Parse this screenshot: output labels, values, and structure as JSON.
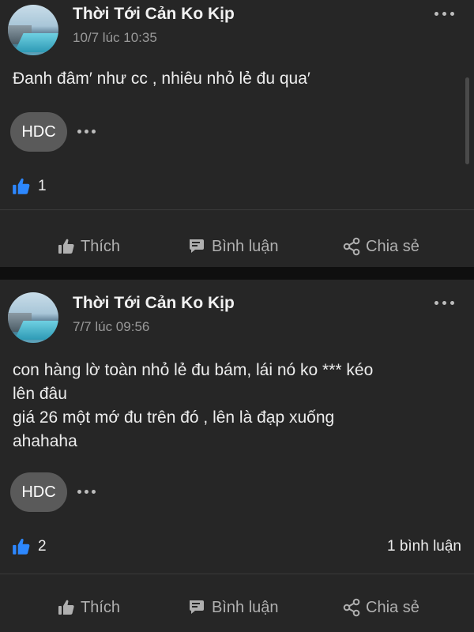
{
  "posts": [
    {
      "author": "Thời Tới Cản Ko Kịp",
      "timestamp": "10/7 lúc 10:35",
      "body": [
        "Đanh đâm′ như cc , nhiêu nhỏ lẻ đu qua′"
      ],
      "reactor_chip": "HDC",
      "like_count": "1",
      "comment_count": ""
    },
    {
      "author": "Thời Tới Cản Ko Kịp",
      "timestamp": "7/7 lúc 09:56",
      "body": [
        "con hàng lờ toàn nhỏ lẻ đu bám, lái nó ko *** kéo",
        "lên đâu",
        "giá 26 một mớ đu trên đó , lên là đạp xuống",
        "ahahaha"
      ],
      "reactor_chip": "HDC",
      "like_count": "2",
      "comment_count": "1 bình luận"
    }
  ],
  "actions": {
    "like": "Thích",
    "comment": "Bình luận",
    "share": "Chia sẻ"
  },
  "icons": {
    "like_reaction": "like-icon",
    "like_action": "thumbs-up-icon",
    "comment_action": "comment-bubble-icon",
    "share_action": "share-icon",
    "more": "more-horizontal-icon"
  },
  "colors": {
    "like_blue": "#2d88ff",
    "post_bg": "#262626",
    "page_bg": "#0f0f0f"
  }
}
